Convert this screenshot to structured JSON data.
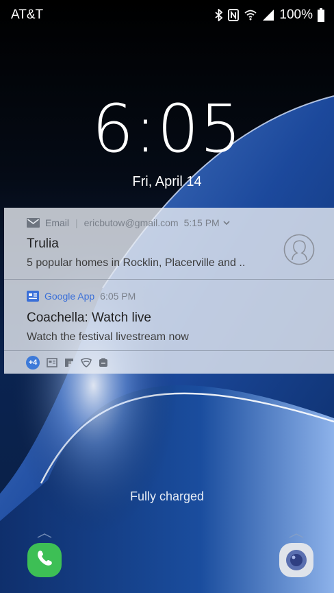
{
  "status_bar": {
    "carrier": "AT&T",
    "battery": "100%",
    "icons": [
      "bluetooth-icon",
      "nfc-icon",
      "wifi-icon",
      "signal-icon",
      "battery-icon"
    ]
  },
  "lockscreen": {
    "time": "6:05",
    "date": "Fri, April 14",
    "charging_status": "Fully charged"
  },
  "notifications": [
    {
      "app": "Email",
      "account": "ericbutow@gmail.com",
      "time": "5:15 PM",
      "title": "Trulia",
      "body": "5 popular homes in Rocklin, Placerville and ..",
      "icon": "email-icon"
    },
    {
      "app": "Google App",
      "time": "6:05 PM",
      "title": "Coachella: Watch live",
      "body": "Watch the festival livestream now",
      "icon": "google-app-icon"
    }
  ],
  "more_notifications": {
    "count_label": "+4",
    "icons": [
      "news-icon",
      "flipboard-icon",
      "shield-icon",
      "clipboard-icon"
    ]
  },
  "shortcuts": {
    "left": "phone-icon",
    "right": "camera-icon"
  },
  "colors": {
    "accent_blue": "#3d7ad9",
    "phone_green": "#3dbf55",
    "panel": "#e8ecf2"
  }
}
